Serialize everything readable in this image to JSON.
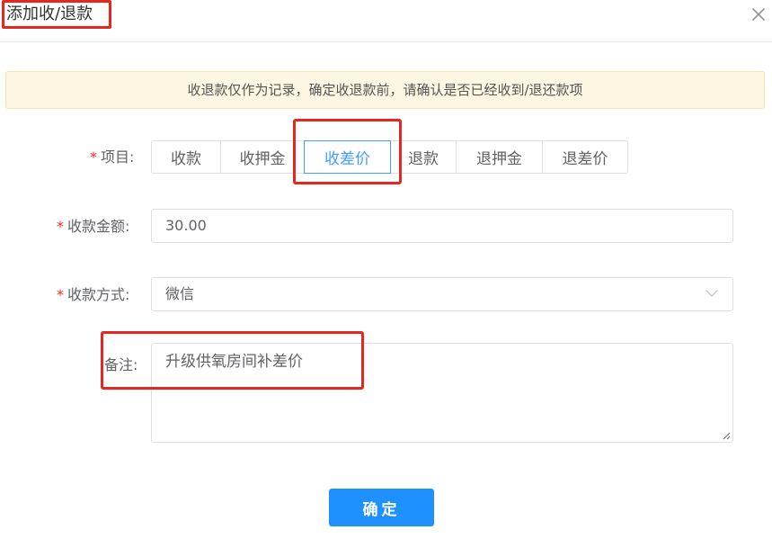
{
  "dialog": {
    "title": "添加收/退款",
    "close_icon": "close-icon"
  },
  "notice": {
    "text": "收退款仅作为记录，确定收退款前，请确认是否已经收到/退还款项"
  },
  "form": {
    "item": {
      "label": "项目:",
      "required": "*",
      "options": [
        "收款",
        "收押金",
        "收差价",
        "退款",
        "退押金",
        "退差价"
      ],
      "selected": "收差价"
    },
    "amount": {
      "label": "收款金额:",
      "required": "*",
      "value": "30.00"
    },
    "method": {
      "label": "收款方式:",
      "required": "*",
      "value": "微信",
      "icon": "chevron-down-icon"
    },
    "remark": {
      "label": "备注:",
      "value": "升级供氧房间补差价"
    }
  },
  "actions": {
    "confirm_label": "确定"
  },
  "colors": {
    "accent": "#409eff",
    "primary_button": "#1e90ff",
    "annotation": "#e8251f",
    "notice_bg": "#fdf6e2"
  }
}
